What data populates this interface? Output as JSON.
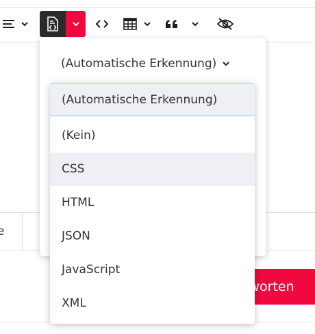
{
  "toolbar": {
    "icons": [
      "align-icon",
      "chevron-down-icon",
      "code-block-icon",
      "code-icon",
      "table-icon",
      "quote-icon",
      "eye-off-icon"
    ],
    "accent_color": "#f0083f",
    "active_button_color": "#2a2a2a"
  },
  "code_language_panel": {
    "selected_label": "(Automatische Erkennung)",
    "options": [
      {
        "label": "(Automatische Erkennung)",
        "state": "selected"
      },
      {
        "label": "(Kein)",
        "state": "normal"
      },
      {
        "label": "CSS",
        "state": "hover"
      },
      {
        "label": "HTML",
        "state": "normal"
      },
      {
        "label": "JSON",
        "state": "normal"
      },
      {
        "label": "JavaScript",
        "state": "normal"
      },
      {
        "label": "XML",
        "state": "normal"
      }
    ]
  },
  "footer": {
    "left_fragment": "e",
    "answer_button_fragment": "tworten"
  }
}
